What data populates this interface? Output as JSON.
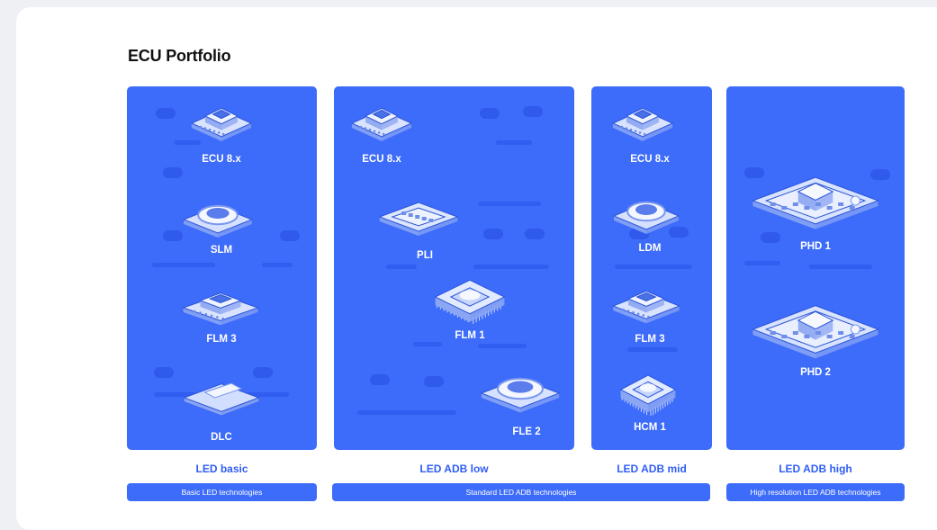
{
  "title": "ECU Portfolio",
  "colors": {
    "panel": "#3d6bfa",
    "category_text": "#2f5ef5",
    "background": "#ffffff"
  },
  "columns": [
    {
      "category": "LED basic",
      "description": "Basic LED technologies",
      "modules": [
        {
          "label": "ECU 8.x",
          "icon": "ecu-module-icon"
        },
        {
          "label": "SLM",
          "icon": "round-module-icon"
        },
        {
          "label": "FLM 3",
          "icon": "ecu-module-icon"
        },
        {
          "label": "DLC",
          "icon": "flat-board-icon"
        }
      ]
    },
    {
      "category": "LED ADB low",
      "description": "Standard LED ADB technologies",
      "modules": [
        {
          "label": "ECU 8.x",
          "icon": "ecu-module-icon"
        },
        {
          "label": "PLI",
          "icon": "board-module-icon"
        },
        {
          "label": "FLM 1",
          "icon": "chip-package-icon"
        },
        {
          "label": "FLE 2",
          "icon": "round-module-icon"
        }
      ]
    },
    {
      "category": "LED ADB mid",
      "description": "",
      "modules": [
        {
          "label": "ECU 8.x",
          "icon": "ecu-module-icon"
        },
        {
          "label": "LDM",
          "icon": "round-module-icon"
        },
        {
          "label": "FLM 3",
          "icon": "ecu-module-icon"
        },
        {
          "label": "HCM 1",
          "icon": "chip-package-icon"
        }
      ]
    },
    {
      "category": "LED ADB high",
      "description": "High resolution LED ADB technologies",
      "modules": [
        {
          "label": "PHD 1",
          "icon": "large-board-icon"
        },
        {
          "label": "PHD 2",
          "icon": "large-board-icon"
        }
      ]
    }
  ]
}
